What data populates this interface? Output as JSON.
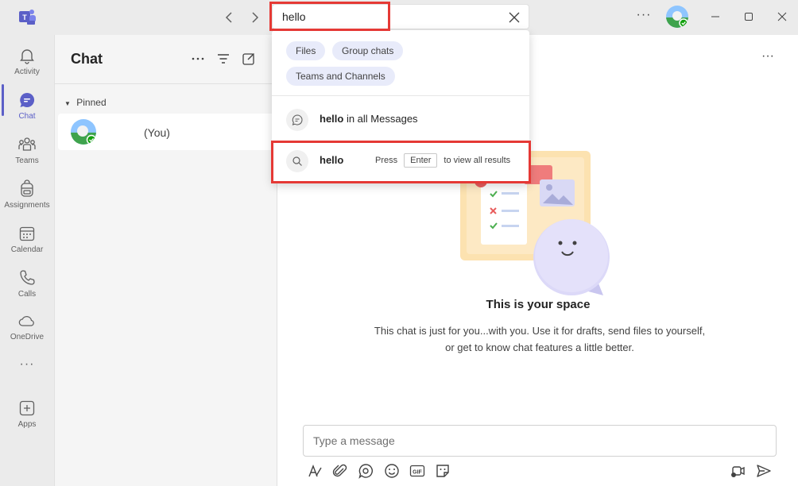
{
  "titlebar": {
    "search_value": "hello",
    "more_label": "···"
  },
  "rail": {
    "items": [
      {
        "label": "Activity",
        "icon": "bell-icon"
      },
      {
        "label": "Chat",
        "icon": "chat-icon"
      },
      {
        "label": "Teams",
        "icon": "teams-icon"
      },
      {
        "label": "Assignments",
        "icon": "backpack-icon"
      },
      {
        "label": "Calendar",
        "icon": "calendar-icon"
      },
      {
        "label": "Calls",
        "icon": "phone-icon"
      },
      {
        "label": "OneDrive",
        "icon": "cloud-icon"
      },
      {
        "label": "···",
        "icon": "more-icon"
      },
      {
        "label": "Apps",
        "icon": "plus-icon"
      }
    ],
    "active": "Chat"
  },
  "chatlist": {
    "title": "Chat",
    "pinned_label": "Pinned",
    "rows": [
      {
        "name": "(You)"
      }
    ]
  },
  "search_dropdown": {
    "filters": [
      "Files",
      "Group chats",
      "Teams and Channels"
    ],
    "message_query": "hello",
    "message_suffix": " in all Messages",
    "result_query": "hello",
    "press_label": "Press",
    "key_label": "Enter",
    "view_all_label": "to view all results"
  },
  "main": {
    "more_label": "···",
    "space_title": "This is your space",
    "space_desc": "This chat is just for you...with you. Use it for drafts, send files to yourself, or get to know chat features a little better.",
    "compose_placeholder": "Type a message"
  },
  "colors": {
    "accent": "#5b5fc7",
    "highlight": "#e53935"
  }
}
